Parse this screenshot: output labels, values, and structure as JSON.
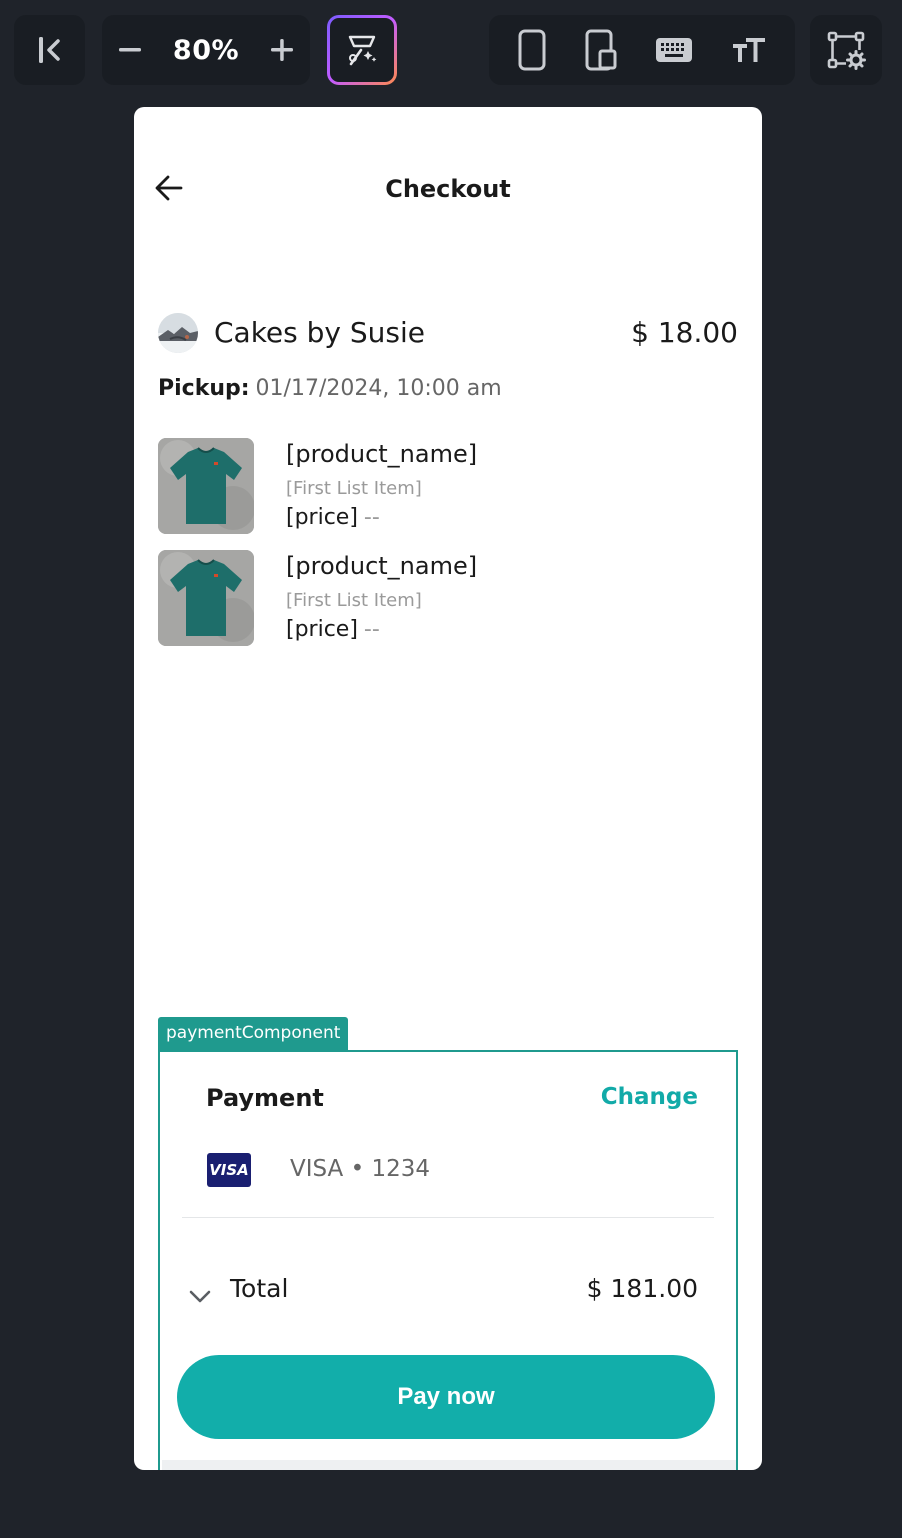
{
  "toolbar": {
    "zoom_label": "80%",
    "icons": {
      "collapse": "collapse-panel-icon",
      "zoom_out": "minus-icon",
      "zoom_in": "plus-icon",
      "ai": "ai-magic-icon",
      "phone": "phone-device-icon",
      "tablet": "tablet-device-icon",
      "keyboard": "keyboard-icon",
      "text_size": "text-size-icon",
      "settings": "component-settings-icon"
    }
  },
  "screen": {
    "title": "Checkout",
    "store": {
      "name": "Cakes by Susie",
      "price": "$ 18.00"
    },
    "pickup": {
      "label": "Pickup:",
      "value": "01/17/2024, 10:00 am"
    },
    "items": [
      {
        "name": "[product_name]",
        "subtitle": "[First List Item]",
        "price": "[price]",
        "extra": "--"
      },
      {
        "name": "[product_name]",
        "subtitle": "[First List Item]",
        "price": "[price]",
        "extra": "--"
      }
    ],
    "payment": {
      "component_tag": "paymentComponent",
      "title": "Payment",
      "change_label": "Change",
      "card_brand": "VISA",
      "card_text": "VISA • 1234",
      "total_label": "Total",
      "total_value": "$ 181.00",
      "pay_button": "Pay now"
    }
  },
  "colors": {
    "background": "#1f232a",
    "toolbar": "#191d23",
    "accent": "#12aeaa",
    "component_outline": "#1f9a8e",
    "visa_blue": "#1a1f71"
  }
}
